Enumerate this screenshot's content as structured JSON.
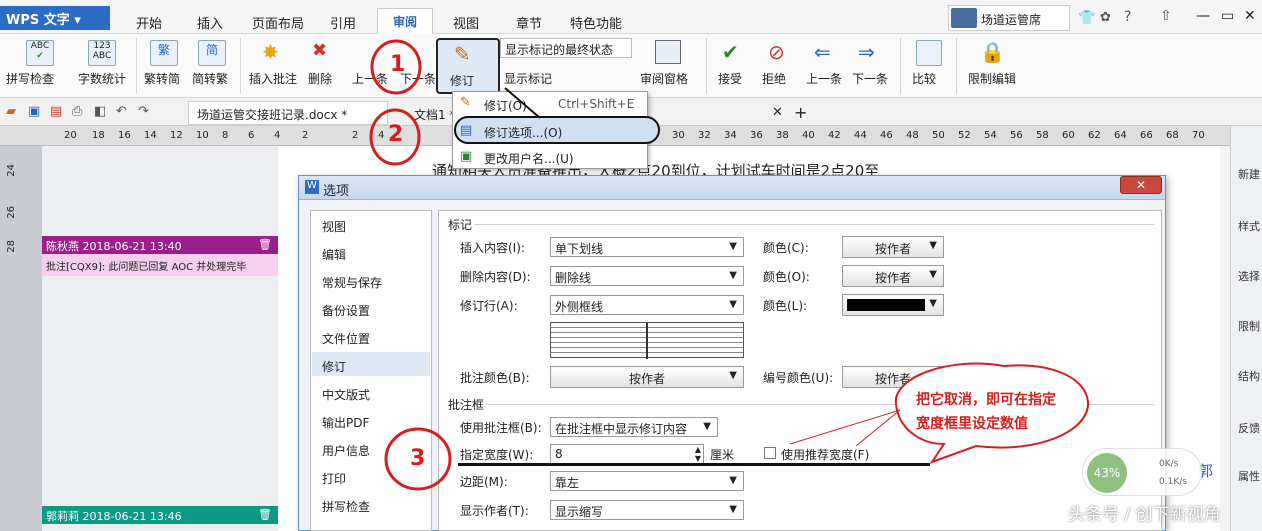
{
  "app": {
    "logo": "WPS 文字",
    "logo_dropdown": "▾"
  },
  "menu_tabs": [
    "开始",
    "插入",
    "页面布局",
    "引用",
    "审阅",
    "视图",
    "章节",
    "特色功能"
  ],
  "user": {
    "name": "场道运管席"
  },
  "window_controls": [
    "—",
    "▭",
    "✕"
  ],
  "ribbon": {
    "spell_check": "拼写检查",
    "word_count": "字数统计",
    "trad_simp": "繁转简",
    "simp_trad": "简转繁",
    "insert_comment": "插入批注",
    "delete": "删除",
    "prev_comment": "上一条",
    "next_comment": "下一条",
    "revise": "修订",
    "display_state": "显示标记的最终状态",
    "show_markup": "显示标记",
    "review_pane": "审阅窗格",
    "accept": "接受",
    "reject": "拒绝",
    "prev_change": "上一条",
    "next_change": "下一条",
    "compare": "比较",
    "restrict_edit": "限制编辑"
  },
  "doc_tabs": [
    {
      "label": "场道运管交接班记录.docx *"
    },
    {
      "label": "文档1 *"
    }
  ],
  "ruler_labels": [
    "20",
    "18",
    "16",
    "14",
    "12",
    "10",
    "8",
    "6",
    "4",
    "2",
    "2",
    "4",
    "30",
    "32",
    "34",
    "36",
    "38",
    "40",
    "42",
    "44",
    "46",
    "48",
    "50",
    "52",
    "54",
    "56",
    "58",
    "60",
    "62",
    "64",
    "66",
    "68",
    "70"
  ],
  "vertical_ruler": [
    "24",
    "26",
    "28"
  ],
  "doc_text": "通知相关人员准备推出，大概2点20到位，计划试车时间是2点20至",
  "dropdown_menu": [
    {
      "label": "修订(O)",
      "shortcut": "Ctrl+Shift+E"
    },
    {
      "label": "修订选项...(O)",
      "shortcut": ""
    },
    {
      "label": "更改用户名...(U)",
      "shortcut": ""
    }
  ],
  "comments": [
    {
      "author_time": "陈秋燕 2018-06-21 13:40",
      "text": "批注[CQX9]: 此问题已回复 AOC 并处理完毕",
      "color": "#9b1f8a"
    },
    {
      "author_time": "郭莉莉 2018-06-21 13:46",
      "text": "",
      "color": "#0a9a85"
    }
  ],
  "dialog": {
    "title": "选项",
    "close": "✕",
    "nav": [
      "视图",
      "编辑",
      "常规与保存",
      "备份设置",
      "文件位置",
      "修订",
      "中文版式",
      "输出PDF",
      "用户信息",
      "打印",
      "拼写检查"
    ],
    "selected_nav": "修订",
    "markup_group": "标记",
    "insert_label": "插入内容(I):",
    "insert_value": "单下划线",
    "delete_label": "删除内容(D):",
    "delete_value": "删除线",
    "changed_lines_label": "修订行(A):",
    "changed_lines_value": "外侧框线",
    "color_c_label": "颜色(C):",
    "color_o_label": "颜色(O):",
    "color_l_label": "颜色(L):",
    "by_author": "按作者",
    "comment_color_label": "批注颜色(B):",
    "number_color_label": "编号颜色(U):",
    "balloon_group": "批注框",
    "use_balloon_label": "使用批注框(B):",
    "use_balloon_value": "在批注框中显示修订内容",
    "width_label": "指定宽度(W):",
    "width_value": "8",
    "width_unit": "厘米",
    "recommend_width": "使用推荐宽度(F)",
    "margin_label": "边距(M):",
    "margin_value": "靠左",
    "show_author_label": "显示作者(T):",
    "show_author_value": "显示缩写"
  },
  "annotations": {
    "n1": "1",
    "n2": "2",
    "n3": "3",
    "note": "把它取消，即可在指定宽度框里设定数值"
  },
  "right_panel": [
    "新建",
    "样式",
    "选择",
    "限制",
    "结构",
    "反馈",
    "属性"
  ],
  "network": {
    "percent": "43%",
    "up": "0K/s",
    "down": "0.1K/s"
  },
  "watermark": "头条号 / 创下新视角",
  "side_text": "郭"
}
